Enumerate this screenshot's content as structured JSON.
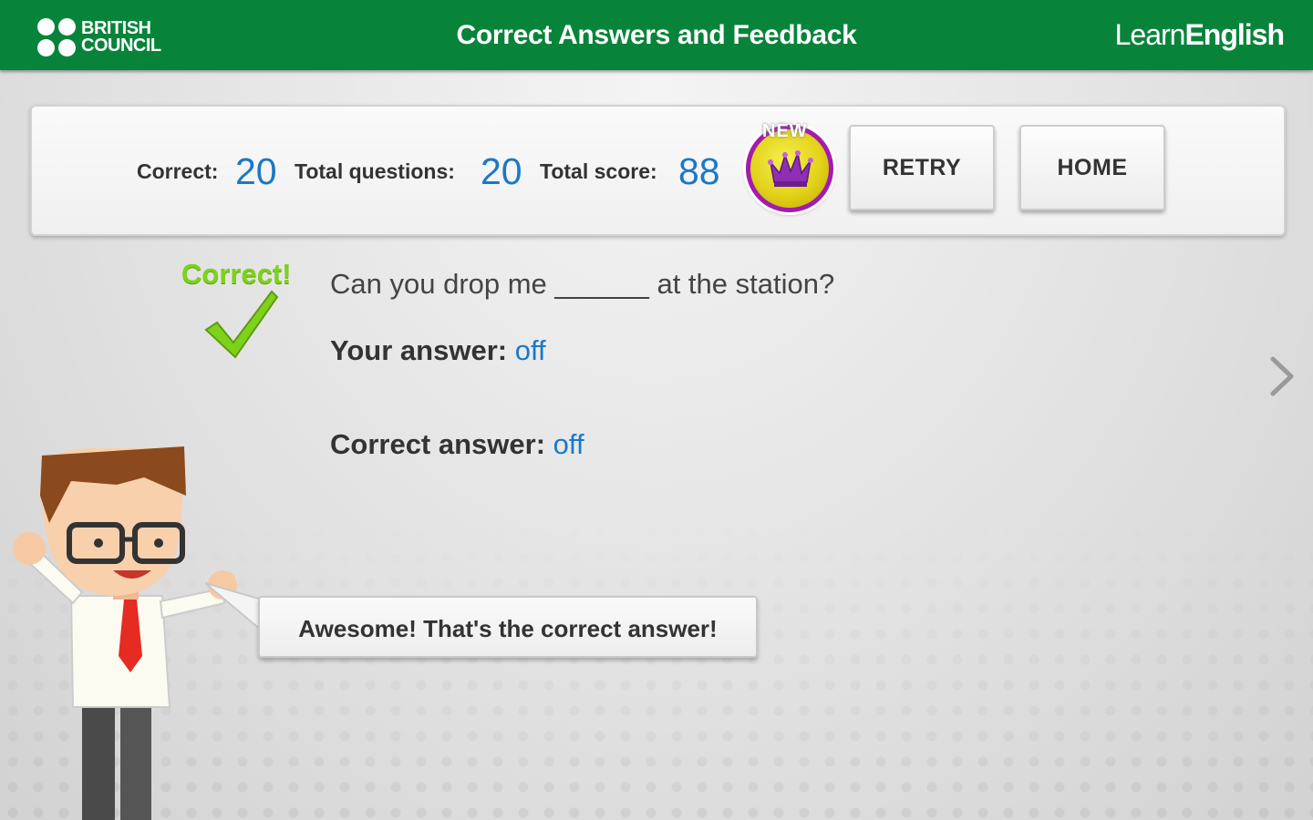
{
  "header": {
    "brand_left_line1": "BRITISH",
    "brand_left_line2": "COUNCIL",
    "title": "Correct Answers and Feedback",
    "brand_right_light": "Learn",
    "brand_right_bold": "English"
  },
  "scores": {
    "correct_label": "Correct:",
    "correct_value": "20",
    "total_questions_label": "Total questions:",
    "total_questions_value": "20",
    "total_score_label": "Total score:",
    "total_score_value": "88",
    "badge_label": "NEW"
  },
  "actions": {
    "retry_label": "RETRY",
    "home_label": "HOME"
  },
  "feedback": {
    "result_label": "Correct!",
    "question": "Can you drop me ______ at the station?",
    "your_answer_label": "Your answer:",
    "your_answer_value": "off",
    "correct_answer_label": "Correct answer:",
    "correct_answer_value": "off",
    "speech": "Awesome!  That's the correct answer!"
  },
  "icons": {
    "logo": "british-council-logo",
    "badge": "crown-badge-icon",
    "check": "checkmark-icon",
    "next": "chevron-right-icon",
    "character": "teacher-character"
  },
  "colors": {
    "header_green": "#08843a",
    "value_blue": "#1a78c8",
    "correct_green": "#7ed21b",
    "badge_purple": "#a41ab1"
  }
}
